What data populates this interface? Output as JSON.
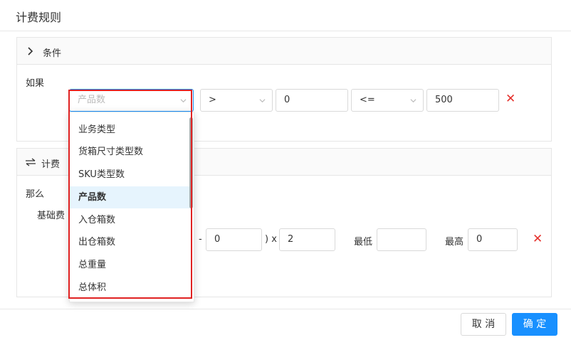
{
  "dialog": {
    "title": "计费规则"
  },
  "condition_section": {
    "header": "条件",
    "if_label": "如果",
    "field_select": {
      "placeholder": "产品数"
    },
    "operator1": ">",
    "value1": "0",
    "operator2": "<=",
    "value2": "500"
  },
  "billing_section": {
    "header": "计费",
    "then_label": "那么",
    "base_fee_label": "基础费",
    "dash": "-",
    "value_a": "0",
    "paren_x": ") x",
    "value_b": "2",
    "min_label": "最低",
    "min_value": "",
    "max_label": "最高",
    "max_value": "0"
  },
  "dropdown": {
    "options": [
      "业务类型",
      "货箱尺寸类型数",
      "SKU类型数",
      "产品数",
      "入仓箱数",
      "出仓箱数",
      "总重量",
      "总体积"
    ],
    "selected": "产品数"
  },
  "footer": {
    "cancel": "取 消",
    "confirm": "确 定"
  },
  "colors": {
    "primary": "#1890ff",
    "danger": "#e5322d",
    "highlight_border": "#e02222",
    "selected_bg": "#e6f4fd"
  }
}
